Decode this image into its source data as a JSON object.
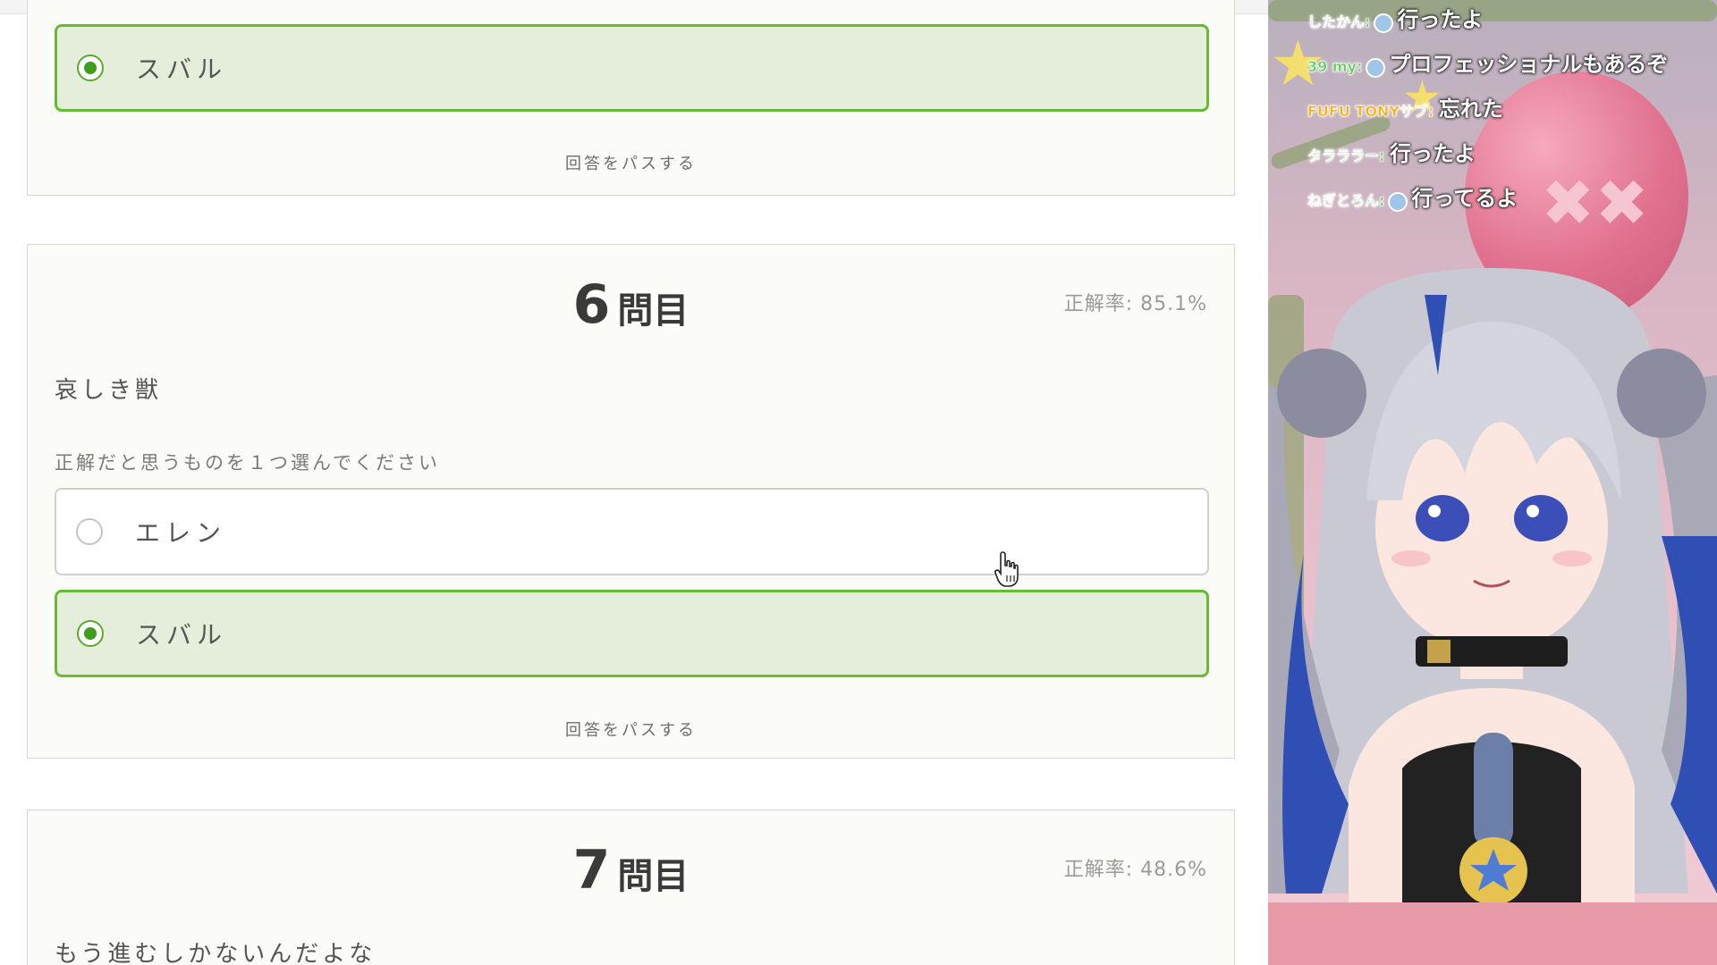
{
  "previous_question": {
    "selected_option": {
      "label": "スバル"
    },
    "pass_label": "回答をパスする"
  },
  "question6": {
    "number": "6",
    "suffix": "問目",
    "accuracy": "正解率: 85.1%",
    "text": "哀しき獣",
    "instruction": "正解だと思うものを１つ選んでください",
    "options": [
      {
        "label": "エレン",
        "selected": false
      },
      {
        "label": "スバル",
        "selected": true
      }
    ],
    "pass_label": "回答をパスする"
  },
  "question7": {
    "number": "7",
    "suffix": "問目",
    "accuracy": "正解率: 48.6%",
    "text": "もう進むしかないんだよな"
  },
  "stream_chat": [
    {
      "name": "したかん:",
      "message": "行ったよ"
    },
    {
      "name": "39 my:",
      "message": "プロフェッショナルもあるぞ"
    },
    {
      "name": "FUFU TONYサブ:",
      "message": "忘れた"
    },
    {
      "name": "タラララー:",
      "message": "行ったよ"
    },
    {
      "name": "ねぎとろん:",
      "message": "行ってるよ"
    }
  ],
  "colors": {
    "selected_fill": "#e5eedb",
    "selected_border": "#66bb33",
    "radio_dot": "#3f9d1c"
  }
}
